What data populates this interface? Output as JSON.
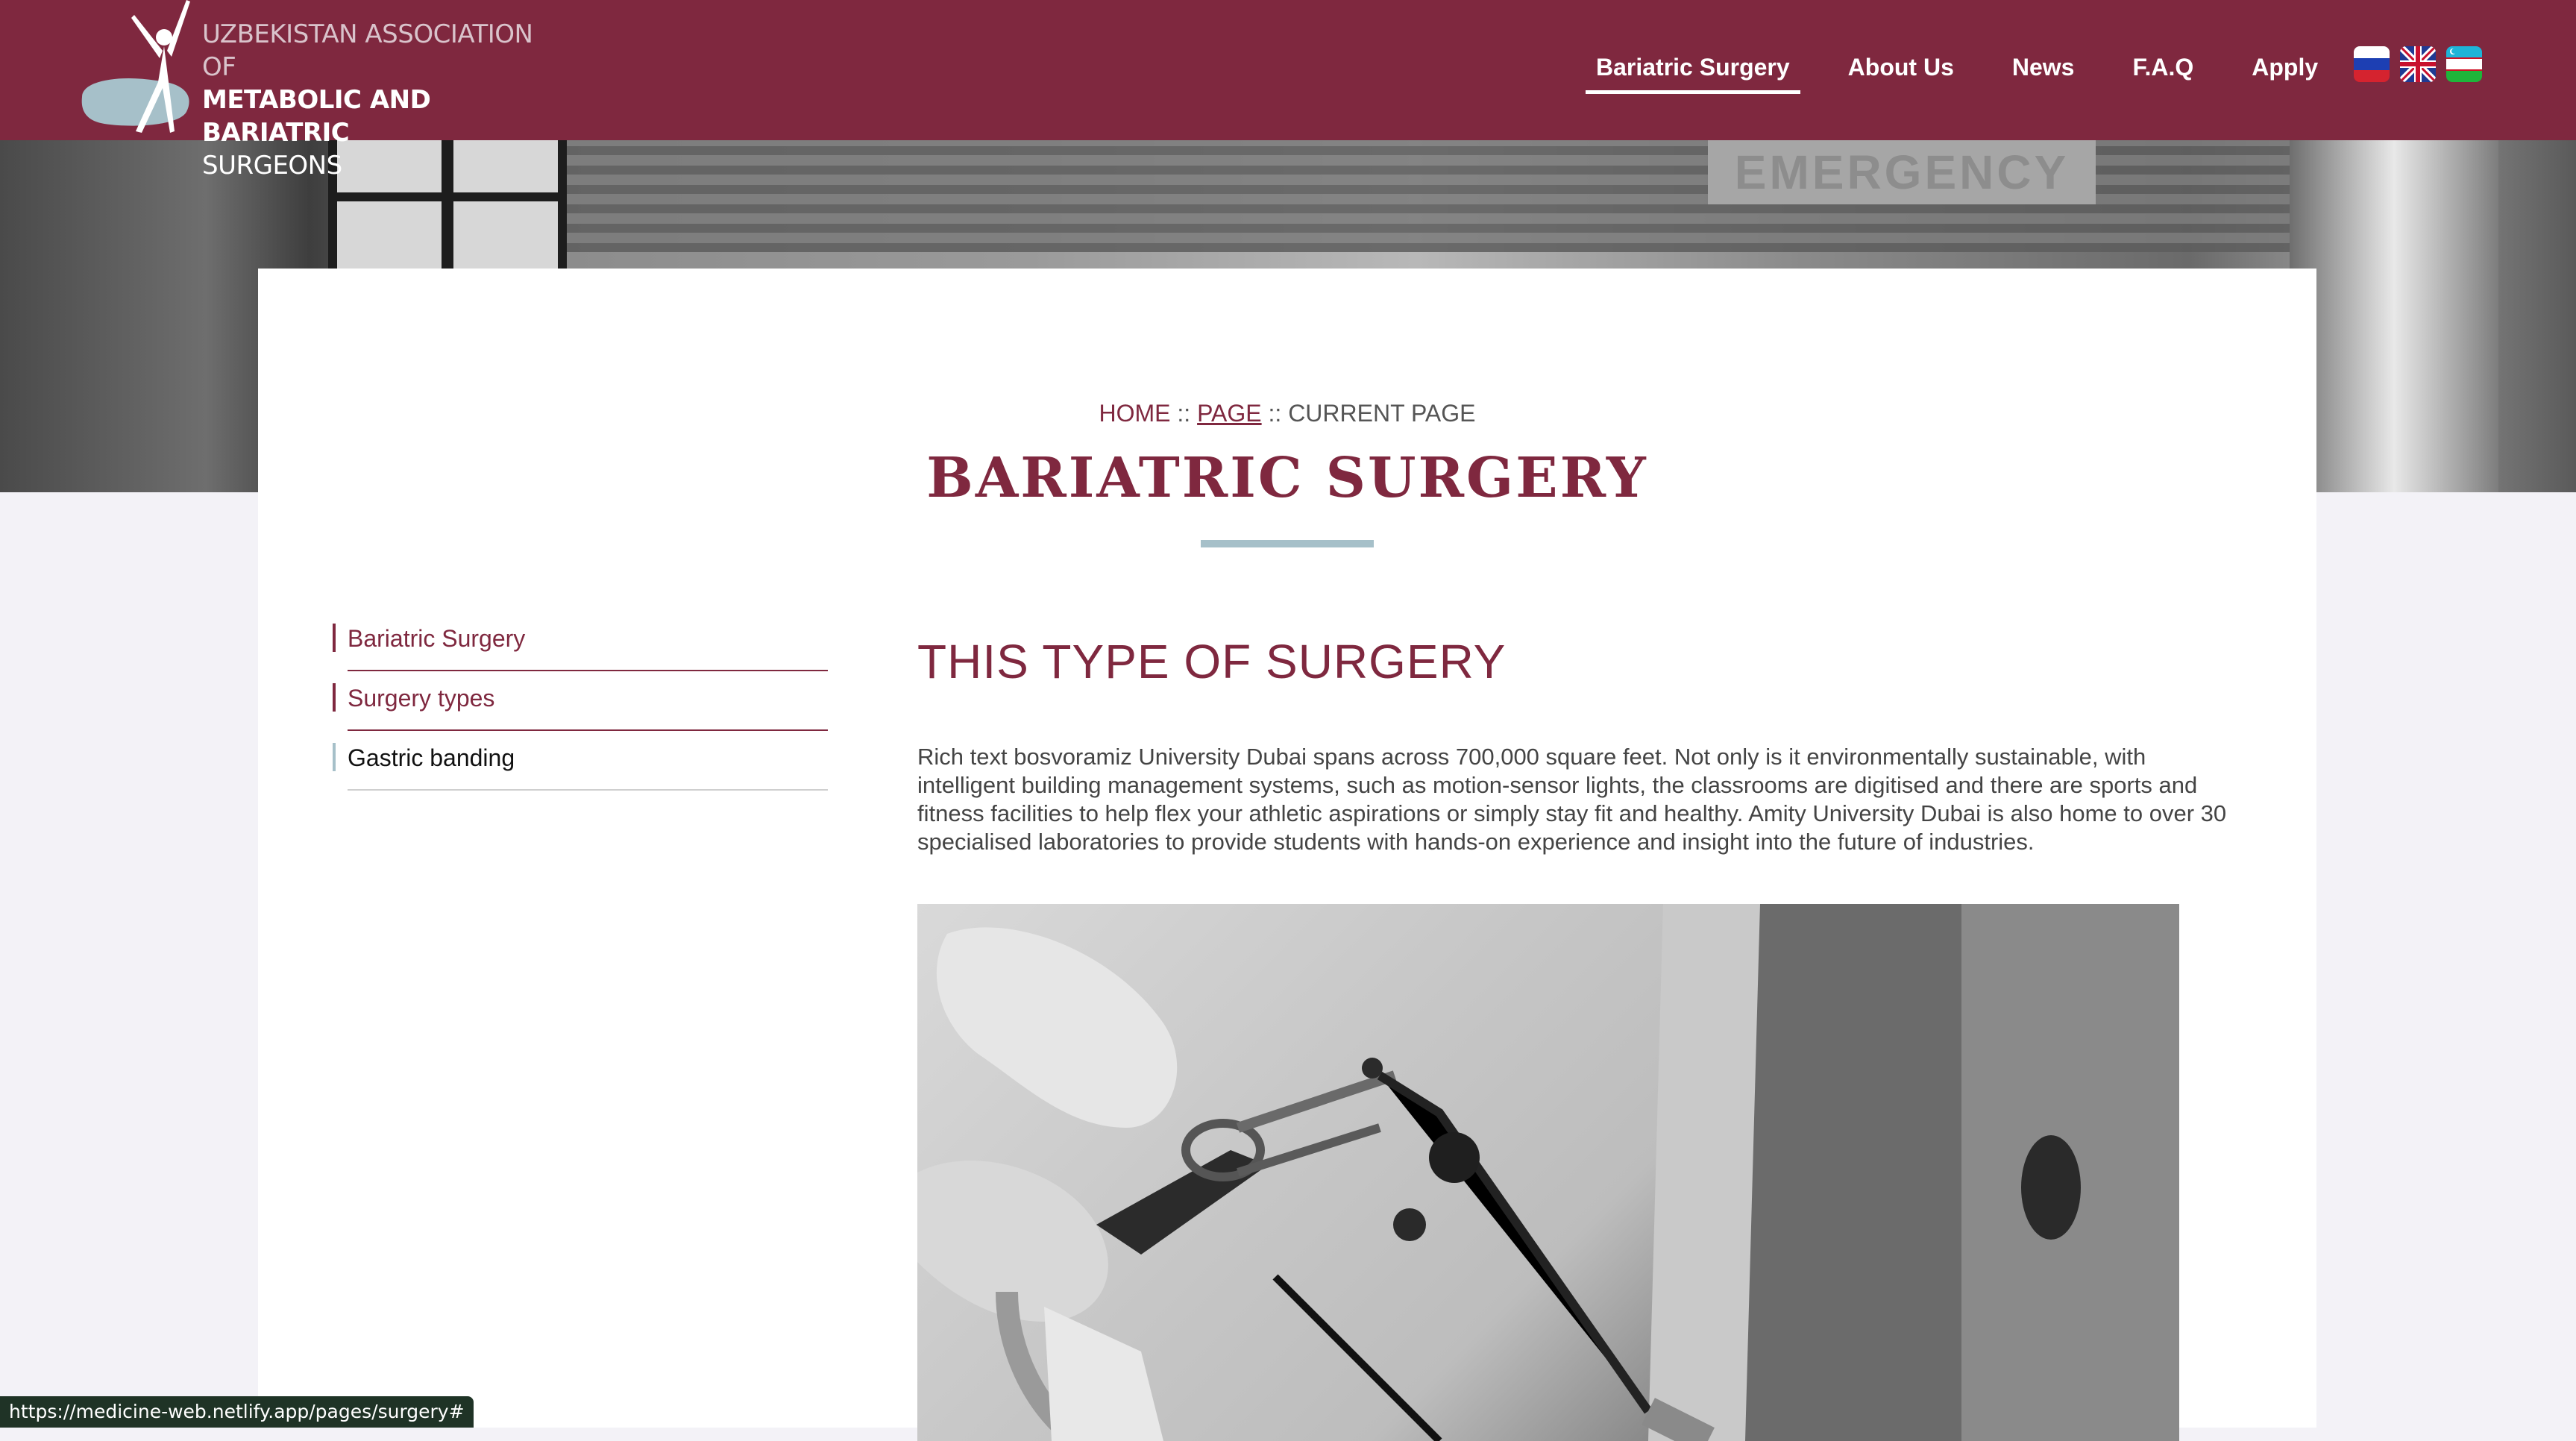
{
  "header": {
    "logo": {
      "line1": "UZBEKISTAN ASSOCIATION OF",
      "line2": "METABOLIC AND BARIATRIC",
      "line3": "SURGEONS"
    },
    "nav": [
      {
        "label": "Bariatric Surgery",
        "active": true
      },
      {
        "label": "About Us"
      },
      {
        "label": "News"
      },
      {
        "label": "F.A.Q"
      },
      {
        "label": "Apply"
      }
    ],
    "languages": [
      "ru-flag-icon",
      "uk-flag-icon",
      "uz-flag-icon"
    ]
  },
  "hero": {
    "sign_text": "EMERGENCY"
  },
  "breadcrumb": {
    "home": "HOME",
    "sep": "::",
    "page": "PAGE",
    "current": "CURRENT PAGE"
  },
  "page_title": "BARIATRIC SURGERY",
  "sidebar": {
    "items": [
      {
        "label": "Bariatric Surgery"
      },
      {
        "label": "Surgery types"
      },
      {
        "label": "Gastric banding"
      }
    ]
  },
  "content": {
    "section_title": "THIS TYPE OF SURGERY",
    "paragraph": "Rich text bosvoramiz University Dubai spans across 700,000 square feet. Not only is it environmentally sustainable, with intelligent building management systems, such as motion-sensor lights, the classrooms are digitised and there are sports and fitness facilities to help flex your athletic aspirations or simply stay fit and healthy. Amity University Dubai is also home to over 30 specialised laboratories to provide students with hands-on experience and insight into the future of industries."
  },
  "status_bar": {
    "url": "https://medicine-web.netlify.app/pages/surgery#"
  },
  "colors": {
    "brand": "#7f283f",
    "accent": "#a6c0c9",
    "background": "#f3f2f7"
  }
}
